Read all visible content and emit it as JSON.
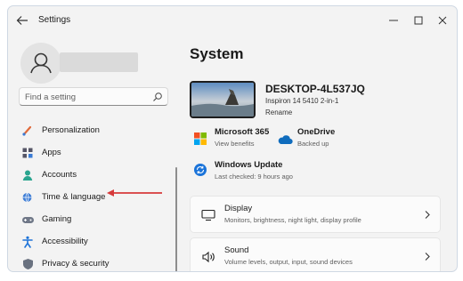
{
  "window": {
    "title": "Settings"
  },
  "search": {
    "placeholder": "Find a setting"
  },
  "sidebar": {
    "items": [
      {
        "label": "Personalization",
        "icon": "brush-icon"
      },
      {
        "label": "Apps",
        "icon": "apps-icon"
      },
      {
        "label": "Accounts",
        "icon": "person-icon"
      },
      {
        "label": "Time & language",
        "icon": "globe-clock-icon"
      },
      {
        "label": "Gaming",
        "icon": "gamepad-icon"
      },
      {
        "label": "Accessibility",
        "icon": "accessibility-icon"
      },
      {
        "label": "Privacy & security",
        "icon": "shield-icon"
      }
    ]
  },
  "main": {
    "heading": "System",
    "device": {
      "name": "DESKTOP-4L537JQ",
      "model": "Inspiron 14 5410 2-in-1",
      "rename": "Rename"
    },
    "tiles": [
      {
        "title": "Microsoft 365",
        "subtitle": "View benefits",
        "icon": "microsoft-logo-icon"
      },
      {
        "title": "OneDrive",
        "subtitle": "Backed up",
        "icon": "cloud-icon"
      },
      {
        "title": "Windows Update",
        "subtitle": "Last checked: 9 hours ago",
        "icon": "sync-icon"
      }
    ],
    "cards": [
      {
        "title": "Display",
        "subtitle": "Monitors, brightness, night light, display profile",
        "icon": "monitor-icon"
      },
      {
        "title": "Sound",
        "subtitle": "Volume levels, output, input, sound devices",
        "icon": "speaker-icon"
      }
    ]
  },
  "colors": {
    "accent": "#0067c0",
    "annotation_arrow": "#d6393a"
  }
}
